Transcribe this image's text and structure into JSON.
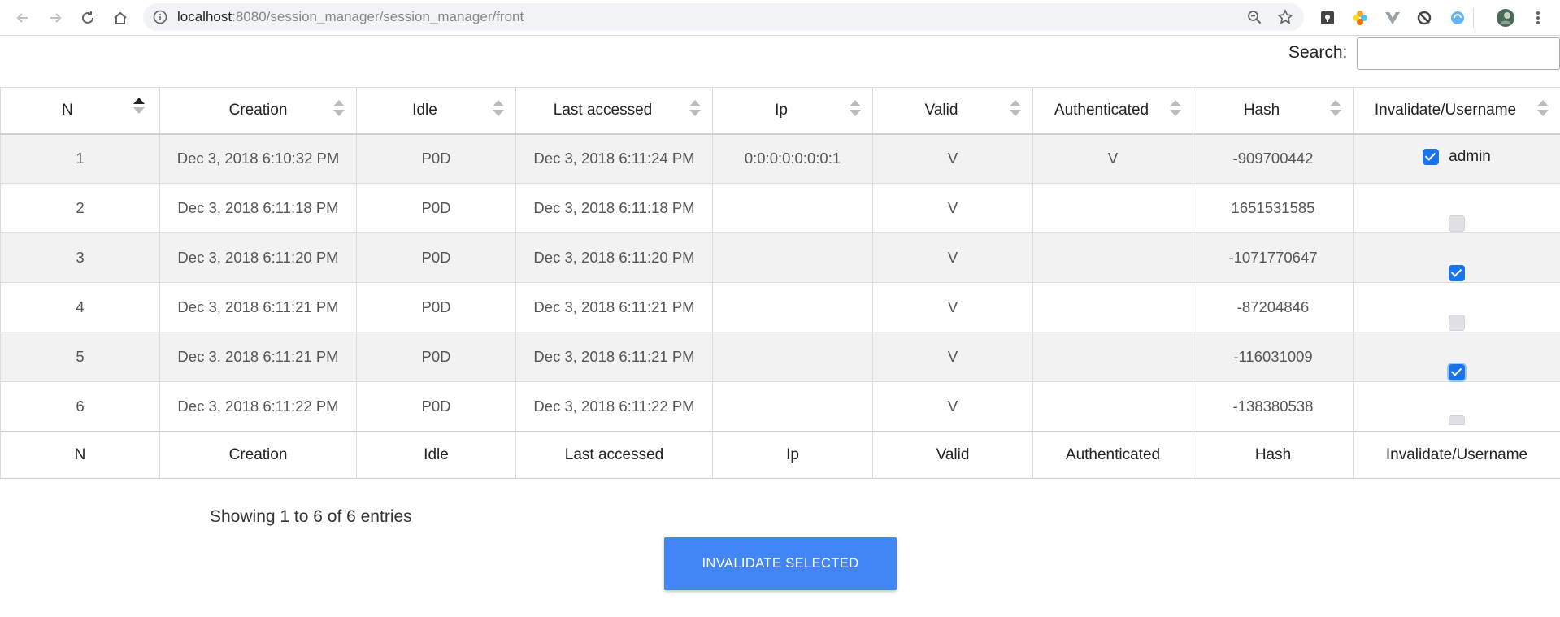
{
  "browser": {
    "url_host": "localhost",
    "url_path": ":8080/session_manager/session_manager/front"
  },
  "search": {
    "label": "Search:",
    "value": ""
  },
  "table": {
    "columns": [
      "N",
      "Creation",
      "Idle",
      "Last accessed",
      "Ip",
      "Valid",
      "Authenticated",
      "Hash",
      "Invalidate/Username"
    ],
    "sorted_column": "N",
    "rows": [
      {
        "n": "1",
        "creation": "Dec 3, 2018 6:10:32 PM",
        "idle": "P0D",
        "last": "Dec 3, 2018 6:11:24 PM",
        "ip": "0:0:0:0:0:0:0:1",
        "valid": "V",
        "auth": "V",
        "hash": "-909700442",
        "checked": true,
        "username": "admin"
      },
      {
        "n": "2",
        "creation": "Dec 3, 2018 6:11:18 PM",
        "idle": "P0D",
        "last": "Dec 3, 2018 6:11:18 PM",
        "ip": "",
        "valid": "V",
        "auth": "",
        "hash": "1651531585",
        "checked": false,
        "username": ""
      },
      {
        "n": "3",
        "creation": "Dec 3, 2018 6:11:20 PM",
        "idle": "P0D",
        "last": "Dec 3, 2018 6:11:20 PM",
        "ip": "",
        "valid": "V",
        "auth": "",
        "hash": "-1071770647",
        "checked": true,
        "username": ""
      },
      {
        "n": "4",
        "creation": "Dec 3, 2018 6:11:21 PM",
        "idle": "P0D",
        "last": "Dec 3, 2018 6:11:21 PM",
        "ip": "",
        "valid": "V",
        "auth": "",
        "hash": "-87204846",
        "checked": false,
        "username": ""
      },
      {
        "n": "5",
        "creation": "Dec 3, 2018 6:11:21 PM",
        "idle": "P0D",
        "last": "Dec 3, 2018 6:11:21 PM",
        "ip": "",
        "valid": "V",
        "auth": "",
        "hash": "-116031009",
        "checked": true,
        "username": ""
      },
      {
        "n": "6",
        "creation": "Dec 3, 2018 6:11:22 PM",
        "idle": "P0D",
        "last": "Dec 3, 2018 6:11:22 PM",
        "ip": "",
        "valid": "V",
        "auth": "",
        "hash": "-138380538",
        "checked": false,
        "username": ""
      }
    ]
  },
  "info": "Showing 1 to 6 of 6 entries",
  "button": {
    "label": "INVALIDATE SELECTED"
  },
  "colors": {
    "accent": "#4285f4",
    "checkbox": "#1a73e8",
    "stripe": "#f2f2f2"
  }
}
